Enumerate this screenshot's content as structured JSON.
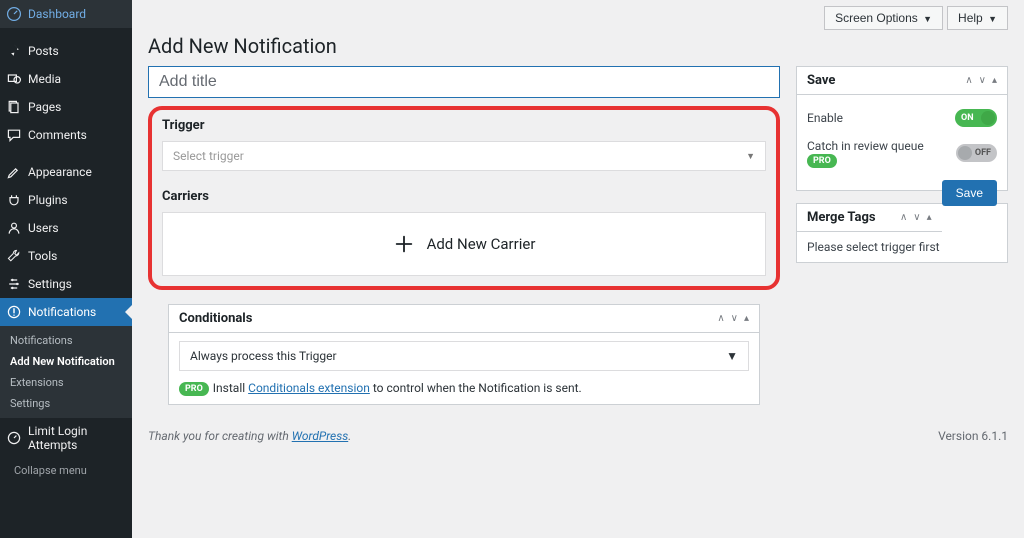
{
  "sidebar": {
    "items": [
      {
        "label": "Dashboard",
        "icon": "dashboard"
      },
      {
        "label": "Posts",
        "icon": "pin"
      },
      {
        "label": "Media",
        "icon": "media"
      },
      {
        "label": "Pages",
        "icon": "page"
      },
      {
        "label": "Comments",
        "icon": "comment"
      },
      {
        "label": "Appearance",
        "icon": "appearance"
      },
      {
        "label": "Plugins",
        "icon": "plugin"
      },
      {
        "label": "Users",
        "icon": "users"
      },
      {
        "label": "Tools",
        "icon": "tools"
      },
      {
        "label": "Settings",
        "icon": "settings"
      },
      {
        "label": "Notifications",
        "icon": "notification"
      },
      {
        "label": "Limit Login Attempts",
        "icon": "limit"
      }
    ],
    "submenu": {
      "items": [
        {
          "label": "Notifications"
        },
        {
          "label": "Add New Notification"
        },
        {
          "label": "Extensions"
        },
        {
          "label": "Settings"
        }
      ]
    },
    "collapse_label": "Collapse menu"
  },
  "topbar": {
    "screen_options": "Screen Options",
    "help": "Help"
  },
  "page": {
    "title": "Add New Notification",
    "title_placeholder": "Add title"
  },
  "trigger": {
    "heading": "Trigger",
    "placeholder": "Select trigger"
  },
  "carriers": {
    "heading": "Carriers",
    "add_label": "Add New Carrier"
  },
  "conditionals": {
    "heading": "Conditionals",
    "selected": "Always process this Trigger",
    "pro_badge": "PRO",
    "note_prefix": "Install ",
    "note_link": "Conditionals extension",
    "note_suffix": " to control when the Notification is sent."
  },
  "save_box": {
    "heading": "Save",
    "enable_label": "Enable",
    "enable_state": "ON",
    "review_label": "Catch in review queue",
    "review_badge": "PRO",
    "review_state": "OFF",
    "save_button": "Save"
  },
  "merge_tags": {
    "heading": "Merge Tags",
    "body": "Please select trigger first"
  },
  "footer": {
    "thanks_prefix": "Thank you for creating with ",
    "thanks_link": "WordPress",
    "version": "Version 6.1.1"
  }
}
